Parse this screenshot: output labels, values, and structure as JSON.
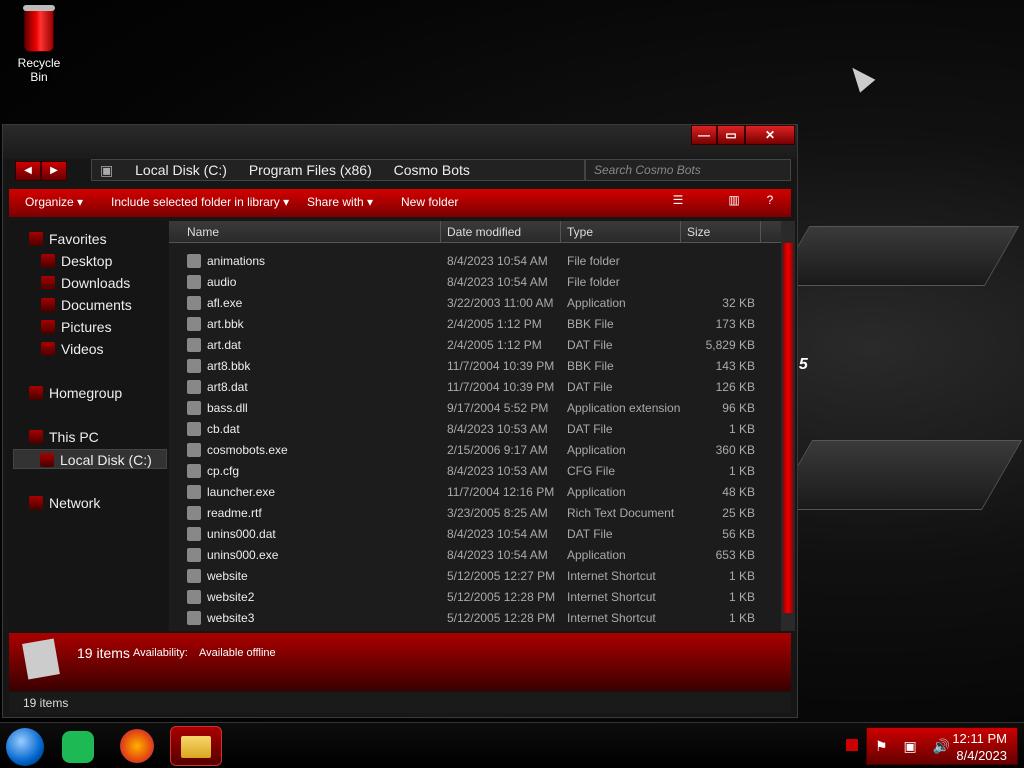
{
  "desktop": {
    "recycle_bin_label": "Recycle Bin"
  },
  "window": {
    "controls": {
      "minimize": "—",
      "maximize": "▭",
      "close": "✕"
    },
    "breadcrumb": [
      "Local Disk (C:)",
      "Program Files (x86)",
      "Cosmo Bots"
    ],
    "search_placeholder": "Search Cosmo Bots",
    "toolbar": {
      "organize": "Organize",
      "include": "Include selected folder in library",
      "share": "Share with",
      "new_folder": "New folder"
    },
    "sidebar": {
      "favorites": "Favorites",
      "desktop": "Desktop",
      "downloads": "Downloads",
      "documents": "Documents",
      "pictures": "Pictures",
      "videos": "Videos",
      "homegroup": "Homegroup",
      "this_pc": "This PC",
      "local_disk": "Local Disk (C:)",
      "network": "Network"
    },
    "columns": {
      "name": "Name",
      "date": "Date modified",
      "type": "Type",
      "size": "Size"
    },
    "files": [
      {
        "name": "animations",
        "date": "8/4/2023 10:54 AM",
        "type": "File folder",
        "size": ""
      },
      {
        "name": "audio",
        "date": "8/4/2023 10:54 AM",
        "type": "File folder",
        "size": ""
      },
      {
        "name": "afl.exe",
        "date": "3/22/2003 11:00 AM",
        "type": "Application",
        "size": "32 KB"
      },
      {
        "name": "art.bbk",
        "date": "2/4/2005 1:12 PM",
        "type": "BBK File",
        "size": "173 KB"
      },
      {
        "name": "art.dat",
        "date": "2/4/2005 1:12 PM",
        "type": "DAT File",
        "size": "5,829 KB"
      },
      {
        "name": "art8.bbk",
        "date": "11/7/2004 10:39 PM",
        "type": "BBK File",
        "size": "143 KB"
      },
      {
        "name": "art8.dat",
        "date": "11/7/2004 10:39 PM",
        "type": "DAT File",
        "size": "126 KB"
      },
      {
        "name": "bass.dll",
        "date": "9/17/2004 5:52 PM",
        "type": "Application extension",
        "size": "96 KB"
      },
      {
        "name": "cb.dat",
        "date": "8/4/2023 10:53 AM",
        "type": "DAT File",
        "size": "1 KB"
      },
      {
        "name": "cosmobots.exe",
        "date": "2/15/2006 9:17 AM",
        "type": "Application",
        "size": "360 KB"
      },
      {
        "name": "cp.cfg",
        "date": "8/4/2023 10:53 AM",
        "type": "CFG File",
        "size": "1 KB"
      },
      {
        "name": "launcher.exe",
        "date": "11/7/2004 12:16 PM",
        "type": "Application",
        "size": "48 KB"
      },
      {
        "name": "readme.rtf",
        "date": "3/23/2005 8:25 AM",
        "type": "Rich Text Document",
        "size": "25 KB"
      },
      {
        "name": "unins000.dat",
        "date": "8/4/2023 10:54 AM",
        "type": "DAT File",
        "size": "56 KB"
      },
      {
        "name": "unins000.exe",
        "date": "8/4/2023 10:54 AM",
        "type": "Application",
        "size": "653 KB"
      },
      {
        "name": "website",
        "date": "5/12/2005 12:27 PM",
        "type": "Internet Shortcut",
        "size": "1 KB"
      },
      {
        "name": "website2",
        "date": "5/12/2005 12:28 PM",
        "type": "Internet Shortcut",
        "size": "1 KB"
      },
      {
        "name": "website3",
        "date": "5/12/2005 12:28 PM",
        "type": "Internet Shortcut",
        "size": "1 KB"
      }
    ],
    "details": {
      "count": "19 items",
      "availability_label": "Availability:",
      "availability_value": "Available offline"
    },
    "status": "19 items"
  },
  "taskbar": {
    "time": "12:11 PM",
    "date": "8/4/2023"
  }
}
